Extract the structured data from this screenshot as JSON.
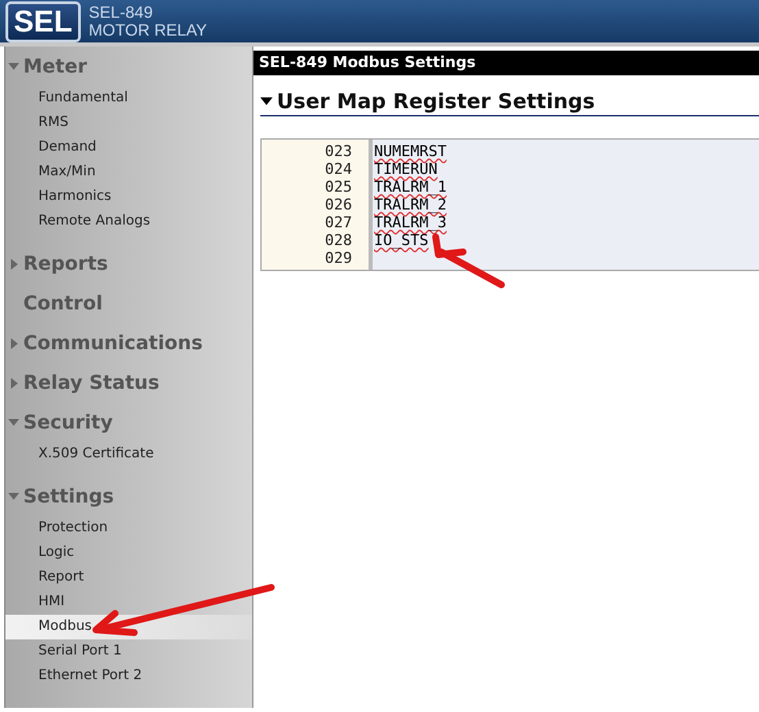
{
  "header": {
    "logo": "SEL",
    "model": "SEL-849",
    "subtitle": "MOTOR RELAY"
  },
  "sidebar": {
    "sections": [
      {
        "label": "Meter",
        "kind": "expandable",
        "expanded": true,
        "items": [
          {
            "label": "Fundamental",
            "selected": false
          },
          {
            "label": "RMS",
            "selected": false
          },
          {
            "label": "Demand",
            "selected": false
          },
          {
            "label": "Max/Min",
            "selected": false
          },
          {
            "label": "Harmonics",
            "selected": false
          },
          {
            "label": "Remote Analogs",
            "selected": false
          }
        ]
      },
      {
        "label": "Reports",
        "kind": "expandable",
        "expanded": false
      },
      {
        "label": "Control",
        "kind": "plain"
      },
      {
        "label": "Communications",
        "kind": "expandable",
        "expanded": false
      },
      {
        "label": "Relay Status",
        "kind": "expandable",
        "expanded": false
      },
      {
        "label": "Security",
        "kind": "expandable",
        "expanded": true,
        "items": [
          {
            "label": "X.509 Certificate",
            "selected": false
          }
        ]
      },
      {
        "label": "Settings",
        "kind": "expandable",
        "expanded": true,
        "items": [
          {
            "label": "Protection",
            "selected": false
          },
          {
            "label": "Logic",
            "selected": false
          },
          {
            "label": "Report",
            "selected": false
          },
          {
            "label": "HMI",
            "selected": false
          },
          {
            "label": "Modbus",
            "selected": true
          },
          {
            "label": "Serial Port 1",
            "selected": false
          },
          {
            "label": "Ethernet Port 2",
            "selected": false
          }
        ]
      }
    ]
  },
  "main": {
    "title": "SEL-849 Modbus Settings",
    "section": {
      "heading": "User Map Register Settings",
      "expanded": true
    },
    "registers": [
      {
        "number": "023",
        "value": "NUMEMRST",
        "misspelled": true
      },
      {
        "number": "024",
        "value": "TIMERUN",
        "misspelled": true
      },
      {
        "number": "025",
        "value": "TRALRM_1",
        "misspelled": true
      },
      {
        "number": "026",
        "value": "TRALRM_2",
        "misspelled": true
      },
      {
        "number": "027",
        "value": "TRALRM_3",
        "misspelled": true
      },
      {
        "number": "028",
        "value": "IO_STS",
        "misspelled": true
      },
      {
        "number": "029"
      }
    ]
  }
}
